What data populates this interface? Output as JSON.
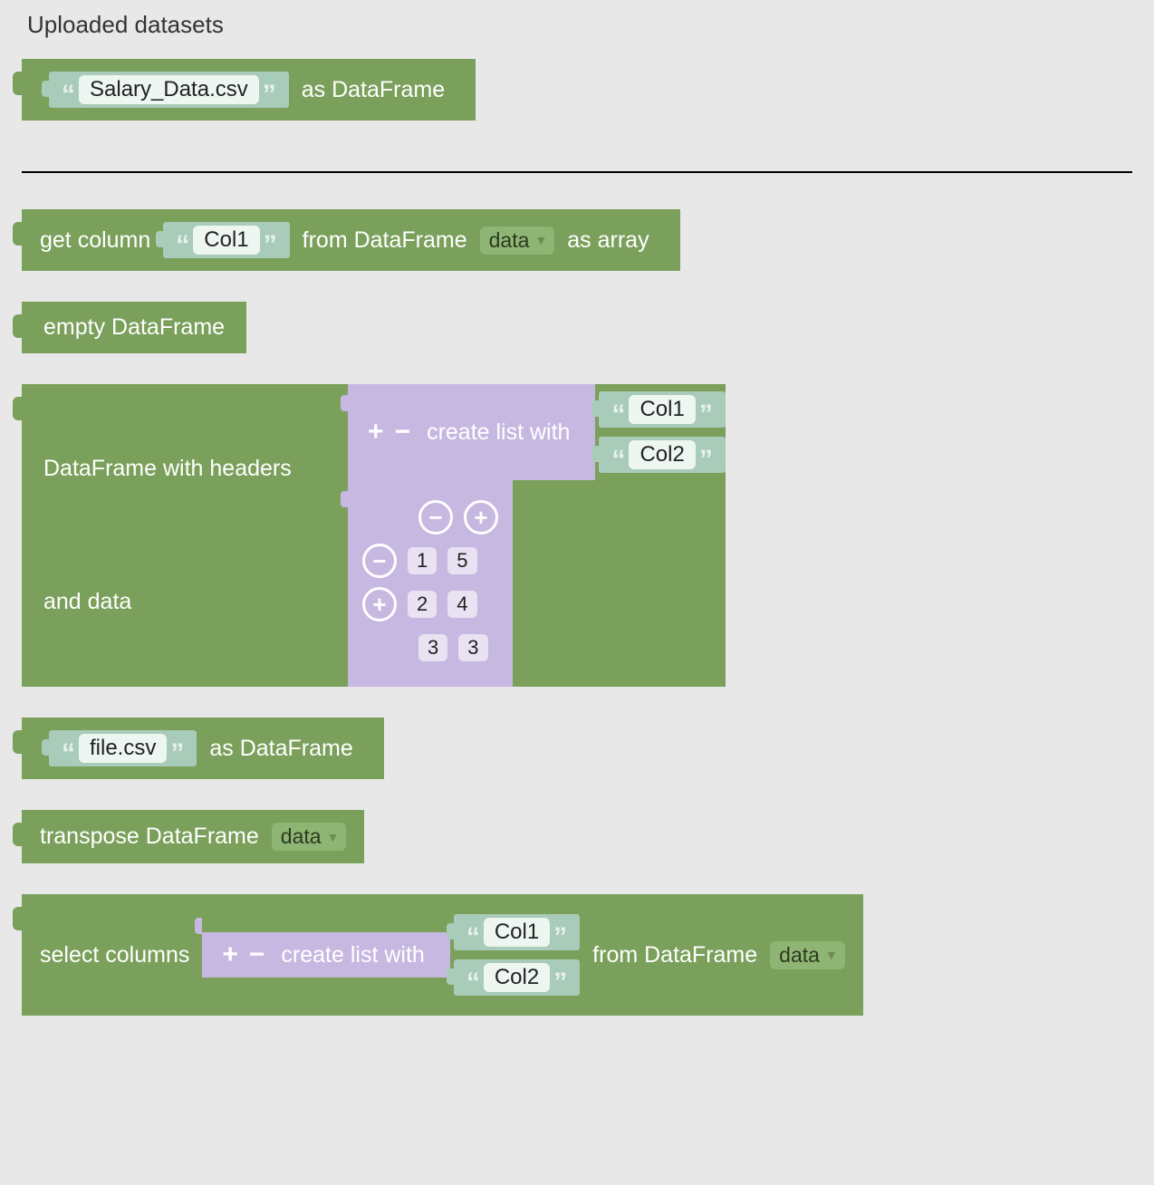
{
  "section_title": "Uploaded datasets",
  "blocks": {
    "uploaded_file": {
      "filename": "Salary_Data.csv",
      "suffix": "as DataFrame"
    },
    "get_column": {
      "prefix": "get column",
      "col": "Col1",
      "mid": "from DataFrame",
      "dropdown": "data",
      "suffix": "as array"
    },
    "empty_df": {
      "label": "empty DataFrame"
    },
    "df_headers": {
      "left_top": "DataFrame with headers",
      "left_bottom": "and data",
      "create_list_label": "create list with",
      "plus": "+",
      "minus": "−",
      "header_cols": [
        "Col1",
        "Col2"
      ],
      "matrix": [
        [
          "1",
          "5"
        ],
        [
          "2",
          "4"
        ],
        [
          "3",
          "3"
        ]
      ]
    },
    "file_csv": {
      "filename": "file.csv",
      "suffix": "as DataFrame"
    },
    "transpose": {
      "label": "transpose DataFrame",
      "dropdown": "data"
    },
    "select_columns": {
      "prefix": "select columns",
      "create_list_label": "create list with",
      "plus": "+",
      "minus": "−",
      "cols": [
        "Col1",
        "Col2"
      ],
      "mid": "from DataFrame",
      "dropdown": "data"
    }
  }
}
